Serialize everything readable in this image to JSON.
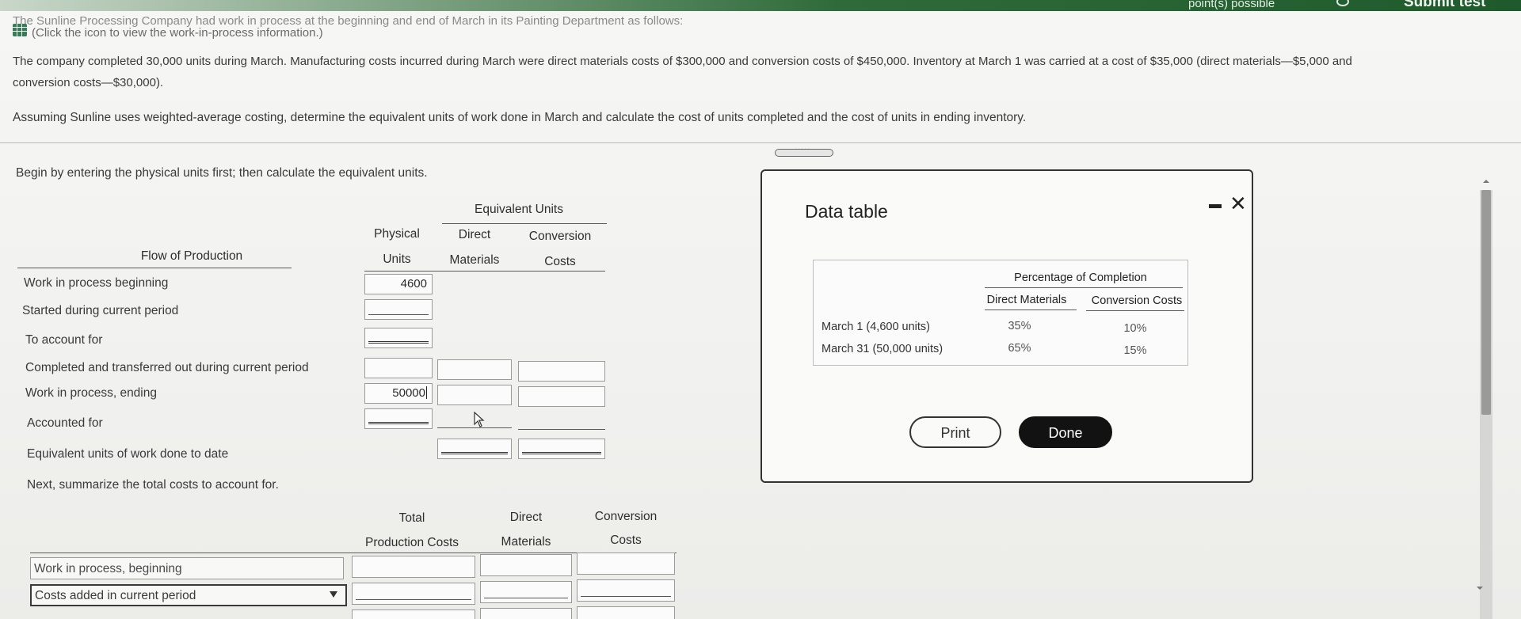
{
  "header": {
    "points_text": "point(s) possible",
    "submit_label": "Submit test"
  },
  "problem": {
    "intro": "The Sunline Processing Company had work in process at the beginning and end of March in its Painting Department as follows:",
    "click_icon_hint": "(Click the icon to view the work-in-process information.)",
    "para1_line1": "The company completed 30,000 units during March. Manufacturing costs incurred during March were direct materials costs of $300,000 and conversion costs of $450,000. Inventory at March 1 was carried at a cost of $35,000 (direct materials—$5,000 and",
    "para1_line2": "conversion costs—$30,000).",
    "para2": "Assuming Sunline uses weighted-average costing, determine the equivalent units of work done in March and calculate the cost of units completed and the cost of units in ending inventory.",
    "step1": "Begin by entering the physical units first; then calculate the equivalent units.",
    "step2": "Next, summarize the total costs to account for."
  },
  "units_table": {
    "group_header": "Equivalent Units",
    "col_physical": [
      "Physical",
      "Units"
    ],
    "col_dm": [
      "Direct",
      "Materials"
    ],
    "col_cc": [
      "Conversion",
      "Costs"
    ],
    "row_header": "Flow of Production",
    "rows": {
      "wip_beginning": {
        "label": "Work in process beginning",
        "physical": "4600"
      },
      "started": {
        "label": "Started during current period",
        "physical": ""
      },
      "to_account": {
        "label": "To account for",
        "physical": ""
      },
      "completed": {
        "label": "Completed and transferred out during current period",
        "physical": "",
        "dm": "",
        "cc": ""
      },
      "wip_ending": {
        "label": "Work in process, ending",
        "physical": "50000",
        "dm": "",
        "cc": ""
      },
      "accounted": {
        "label": "Accounted for",
        "physical": ""
      },
      "equiv": {
        "label": "Equivalent units of work done to date",
        "dm": "",
        "cc": ""
      }
    }
  },
  "costs_table": {
    "col_total": [
      "Total",
      "Production Costs"
    ],
    "col_dm": [
      "Direct",
      "Materials"
    ],
    "col_cc": [
      "Conversion",
      "Costs"
    ],
    "row1_label": "Work in process, beginning",
    "row2_select": "Costs added in current period"
  },
  "modal": {
    "title": "Data table",
    "table_header": "Percentage of Completion",
    "col_dm": "Direct Materials",
    "col_cc": "Conversion Costs",
    "rows": [
      {
        "label": "March 1 (4,600 units)",
        "dm": "35%",
        "cc": "10%"
      },
      {
        "label": "March 31 (50,000 units)",
        "dm": "65%",
        "cc": "15%"
      }
    ],
    "print_label": "Print",
    "done_label": "Done"
  },
  "colors": {
    "accent_green": "#2f6b3a",
    "done_button": "#121212"
  },
  "icons": [
    "grid-icon",
    "minimize-icon",
    "close-icon",
    "dropdown-arrow-icon",
    "scroll-up-icon",
    "scroll-down-icon",
    "mouse-cursor-icon"
  ]
}
